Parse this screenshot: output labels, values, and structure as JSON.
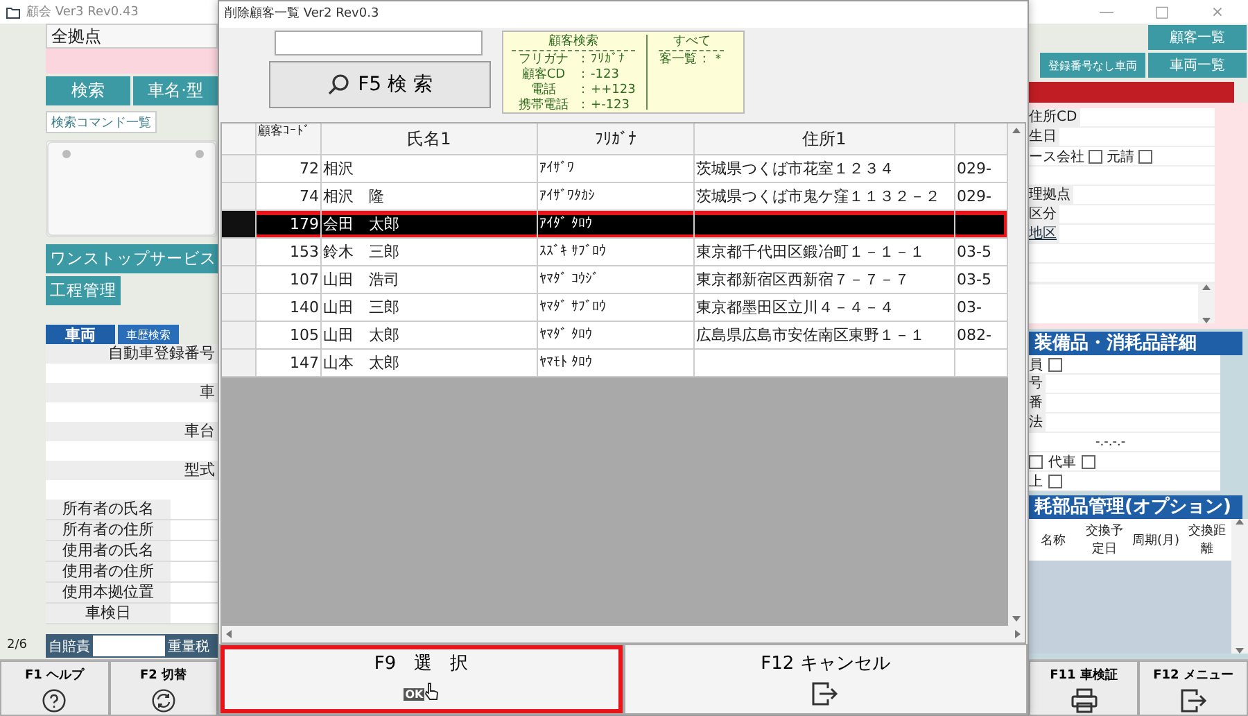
{
  "window": {
    "title": "顧会 Ver3 Rev0.43",
    "controls": [
      "—",
      "□",
      "×"
    ]
  },
  "left_panel": {
    "location_field": "全拠点",
    "tabs": [
      "検索",
      "車名·型"
    ],
    "command_list_button": "検索コマンド一覧",
    "service_buttons": [
      "ワンストップサービス",
      "工程管理"
    ],
    "vehicle_tab": "車両",
    "history_search_button": "車歴検索",
    "vehicle_fields": [
      "自動車登録番号",
      "車",
      "車台",
      "型式"
    ],
    "owner_rows": [
      "所有者の氏名",
      "所有者の住所",
      "使用者の氏名",
      "使用者の住所",
      "使用本拠位置",
      "車検日"
    ],
    "page": "2/6",
    "tax_labels": [
      "自賠責",
      "重量税"
    ]
  },
  "right_panel": {
    "top_buttons": [
      "顧客一覧"
    ],
    "second_buttons": [
      "登録番号なし車両",
      "車両一覧"
    ],
    "customer_rows": [
      {
        "kind": "field",
        "label": "住所CD"
      },
      {
        "kind": "field",
        "label": "生日"
      },
      {
        "kind": "checks",
        "items": [
          {
            "label": "ース会社",
            "checked": false
          },
          {
            "label": "元請",
            "checked": false
          }
        ]
      },
      {
        "kind": "blank"
      },
      {
        "kind": "field",
        "label": "理拠点"
      },
      {
        "kind": "field",
        "label": "区分"
      },
      {
        "kind": "link",
        "label": "地区"
      },
      {
        "kind": "blank"
      },
      {
        "kind": "blank"
      },
      {
        "kind": "memo"
      }
    ],
    "equipment_title": "装備品・消耗品詳細",
    "equipment_rows": [
      {
        "kind": "checks",
        "items": [
          {
            "label": "員",
            "checked": false
          }
        ]
      },
      {
        "kind": "field",
        "label": "号"
      },
      {
        "kind": "field",
        "label": "番"
      },
      {
        "kind": "field",
        "label": "法"
      },
      {
        "kind": "date",
        "value": "-.-.-.-"
      },
      {
        "kind": "checks",
        "items": [
          {
            "checked": false
          },
          {
            "label": "代車",
            "checked": false
          }
        ]
      },
      {
        "kind": "checks",
        "items": [
          {
            "label": "上",
            "checked": false
          }
        ]
      }
    ],
    "parts_title": "耗部品管理(オプション)",
    "parts_columns": [
      "名称",
      "交換予定日",
      "周期(月)",
      "交換距離"
    ]
  },
  "function_keys_left": [
    {
      "label": "F1 ヘルプ",
      "kind": "help"
    },
    {
      "label": "F2 切替",
      "kind": "refresh"
    }
  ],
  "function_keys_right": [
    {
      "label": "F11 車検証",
      "kind": "printer"
    },
    {
      "label": "F12 メニュー",
      "kind": "exit"
    }
  ],
  "dialog": {
    "title": "削除顧客一覧 Ver2 Rev0.3",
    "search_button": "F5 検 索",
    "info": {
      "heading": "顧客検索",
      "rows": [
        {
          "label": "フリガナ",
          "separator": ":",
          "value": "ﾌﾘｶﾞﾅ"
        },
        {
          "label": "顧客CD",
          "separator": ":",
          "value": "-123"
        },
        {
          "label": "電話",
          "separator": ":",
          "value": "++123"
        },
        {
          "label": "携帯電話",
          "separator": ":",
          "value": "+-123"
        }
      ],
      "all_heading": "すべて",
      "all_rows": [
        {
          "label": "客一覧",
          "separator": ":",
          "value": "＊"
        }
      ]
    },
    "table": {
      "columns": [
        "顧客ｺｰﾄﾞ",
        "氏名1",
        "ﾌﾘｶﾞﾅ",
        "住所1"
      ],
      "rows": [
        {
          "code": "72",
          "name": "相沢",
          "kana": "ｱｲｻﾞﾜ",
          "address": "茨城県つくば市花室１２３４",
          "column_5": "029-",
          "selected": false,
          "highlighted": false
        },
        {
          "code": "74",
          "name": "相沢　隆",
          "kana": "ｱｲｻﾞﾜﾀｶｼ",
          "address": "茨城県つくば市鬼ケ窪１１３２－２",
          "column_5": "029-",
          "selected": false,
          "highlighted": false
        },
        {
          "code": "179",
          "name": "会田　太郎",
          "kana": "ｱｲﾀﾞ ﾀﾛｳ",
          "selected": true,
          "highlighted": true
        },
        {
          "code": "153",
          "name": "鈴木　三郎",
          "kana": "ｽｽﾞｷ ｻﾌﾞﾛｳ",
          "address": "東京都千代田区鍛冶町１－１－１",
          "column_5": "03-5",
          "selected": false,
          "highlighted": false
        },
        {
          "code": "107",
          "name": "山田　浩司",
          "kana": "ﾔﾏﾀﾞ ｺｳｼﾞ",
          "address": "東京都新宿区西新宿７－７－７",
          "column_5": "03-5",
          "selected": false,
          "highlighted": false
        },
        {
          "code": "140",
          "name": "山田　三郎",
          "kana": "ﾔﾏﾀﾞ ｻﾌﾞﾛｳ",
          "address": "東京都墨田区立川４－４－４",
          "column_5": "03-",
          "selected": false,
          "highlighted": false
        },
        {
          "code": "105",
          "name": "山田　太郎",
          "kana": "ﾔﾏﾀﾞ ﾀﾛｳ",
          "address": "広島県広島市安佐南区東野１－１",
          "column_5": "082-",
          "selected": false,
          "highlighted": false
        },
        {
          "code": "147",
          "name": "山本　太郎",
          "kana": "ﾔﾏﾓﾄ ﾀﾛｳ",
          "selected": false,
          "highlighted": false
        }
      ]
    },
    "buttons": [
      {
        "label": "F9　選　択",
        "kind": "ok",
        "icon_text": "OK",
        "highlighted": true
      },
      {
        "label": "F12 キャンセル",
        "kind": "exit",
        "highlighted": false
      }
    ]
  }
}
